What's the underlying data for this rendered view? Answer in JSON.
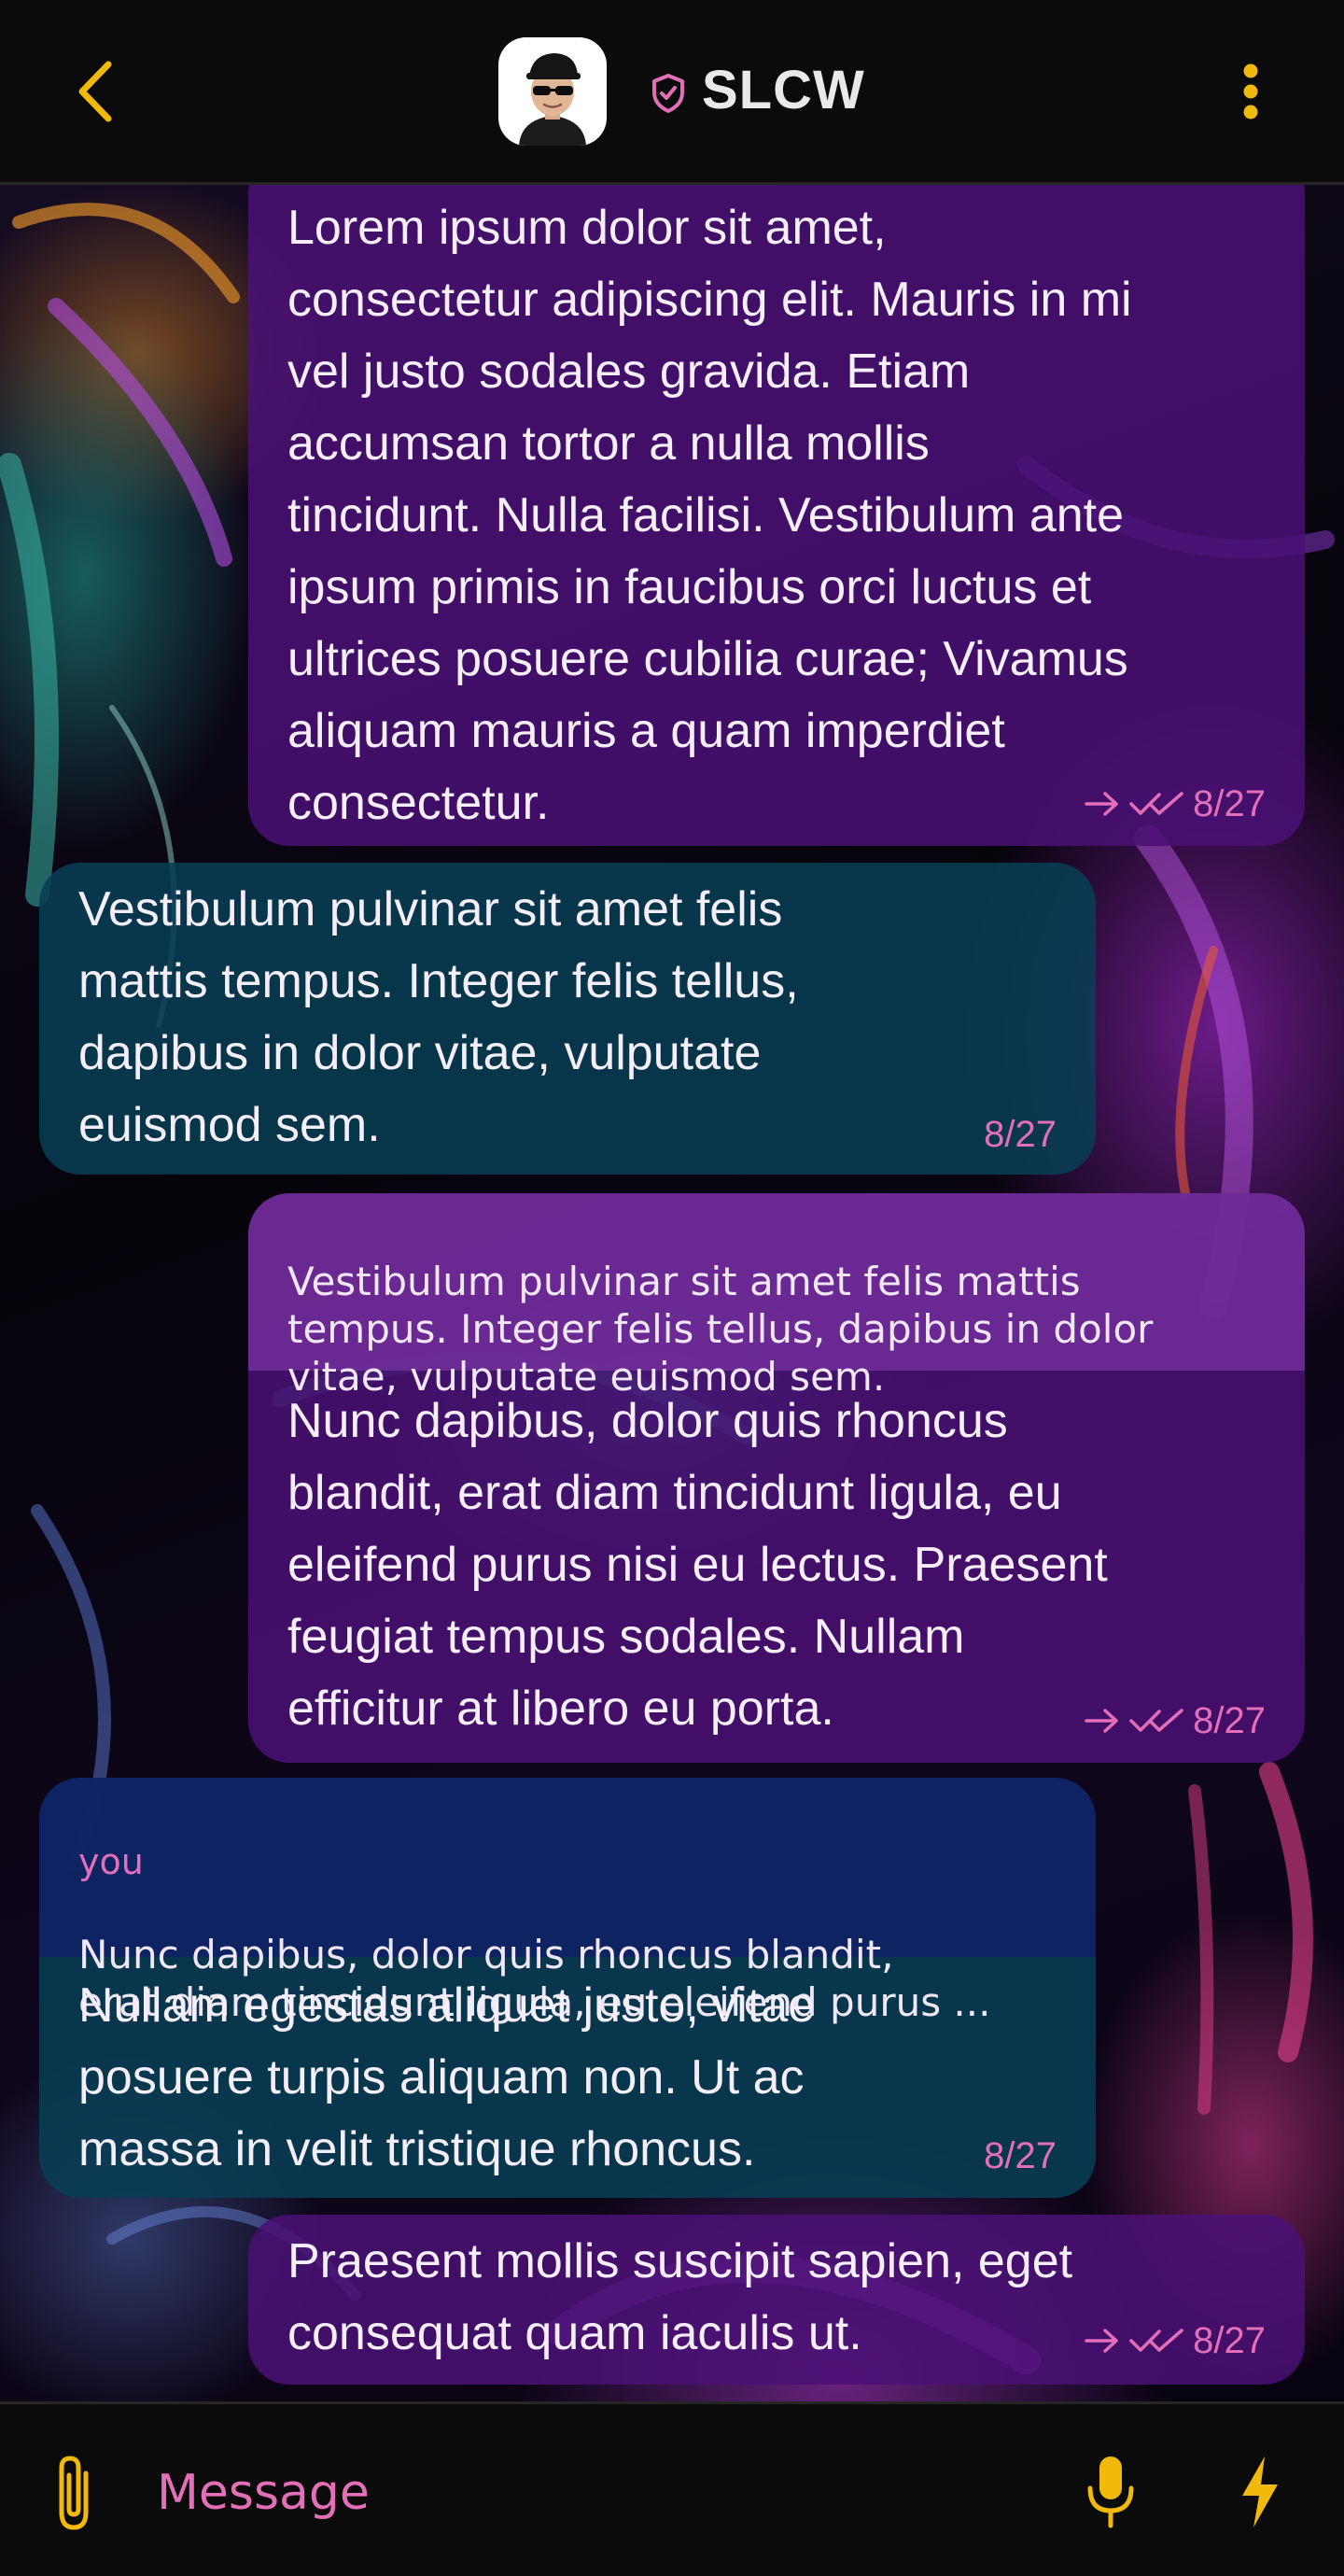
{
  "header": {
    "title": "SLCW",
    "back_icon": "chevron-left-icon",
    "verified_icon": "shield-check-icon",
    "menu_icon": "kebab-menu-icon",
    "accent_color": "#f0b90b",
    "verified_color": "#e36fb8"
  },
  "messages": [
    {
      "direction": "outgoing",
      "text": "Lorem ipsum dolor sit amet,\nconsectetur adipiscing elit. Mauris in mi\nvel justo sodales gravida. Etiam\naccumsan tortor a nulla mollis\ntincidunt. Nulla facilisi. Vestibulum ante\nipsum primis in faucibus orci luctus et\nultrices posuere cubilia curae; Vivamus\naliquam mauris a quam imperdiet\nconsectetur.",
      "date": "8/27",
      "status": "read"
    },
    {
      "direction": "incoming",
      "text": "Vestibulum pulvinar sit amet felis\nmattis tempus. Integer felis tellus,\ndapibus in dolor vitae, vulputate\neuismod sem.",
      "date": "8/27"
    },
    {
      "direction": "outgoing",
      "quote": "Vestibulum pulvinar sit amet felis mattis\ntempus. Integer felis tellus, dapibus in dolor\nvitae, vulputate euismod sem.",
      "text": "Nunc dapibus, dolor quis rhoncus\nblandit, erat diam tincidunt ligula, eu\neleifend purus nisi eu lectus. Praesent\nfeugiat tempus sodales. Nullam\nefficitur at libero eu porta.",
      "date": "8/27",
      "status": "read"
    },
    {
      "direction": "incoming",
      "quote_author": "you",
      "quote": "Nunc dapibus, dolor quis rhoncus blandit,\nerat diam tincidunt ligula, eu eleifend purus ...",
      "text": "Nullam egestas aliquet justo, vitae\nposuere turpis aliquam non. Ut ac\nmassa in velit tristique rhoncus.",
      "date": "8/27"
    },
    {
      "direction": "outgoing",
      "text": "Praesent mollis suscipit sapien, eget\nconsequat quam iaculis ut.",
      "date": "8/27",
      "status": "read"
    }
  ],
  "composer": {
    "placeholder": "Message",
    "attach_icon": "paperclip-icon",
    "mic_icon": "microphone-icon",
    "bolt_icon": "lightning-bolt-icon"
  },
  "colors": {
    "outgoing_bubble": "#4a1076",
    "incoming_bubble": "#083e54",
    "meta_text": "#e36fb8",
    "background": "#000000"
  }
}
